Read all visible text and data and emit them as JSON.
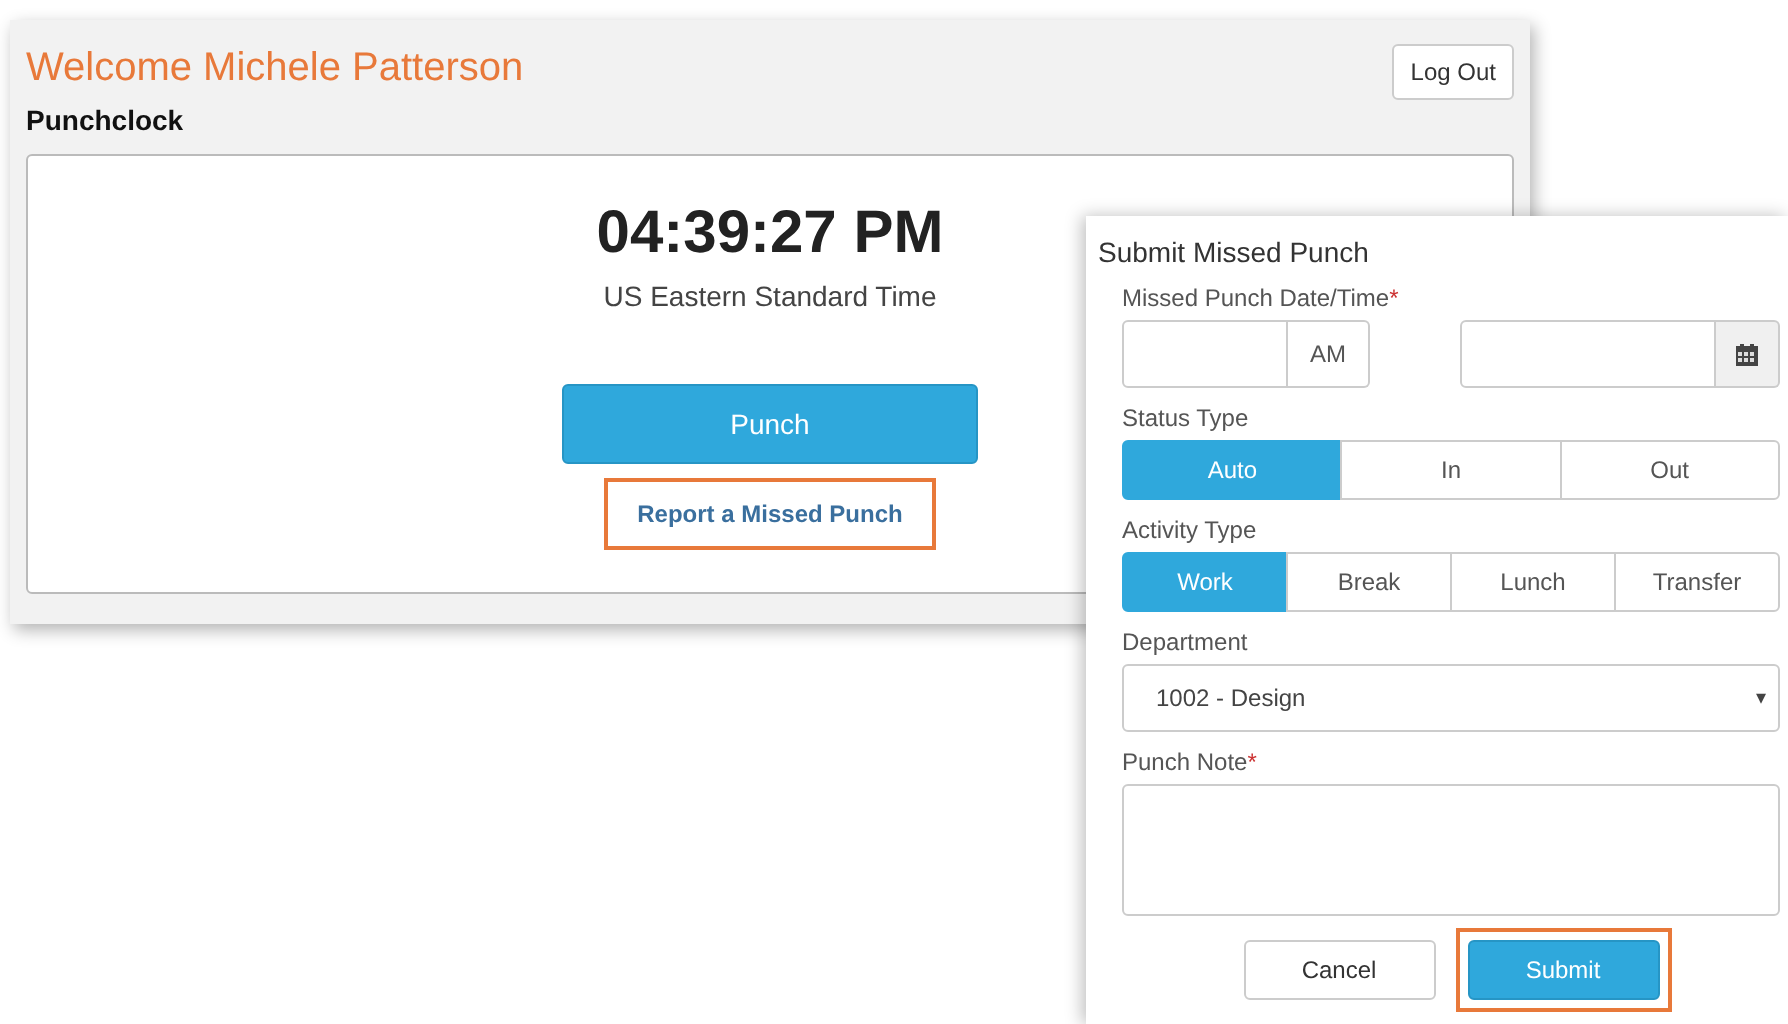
{
  "header": {
    "welcome": "Welcome Michele Patterson",
    "logout_button": "Log Out"
  },
  "punchclock": {
    "title": "Punchclock",
    "time": "04:39:27 PM",
    "timezone": "US Eastern Standard Time",
    "punch_button": "Punch",
    "missed_link": {
      "label": "Report a Missed Punch",
      "highlighted": true
    }
  },
  "dialog": {
    "title": "Submit Missed Punch",
    "datetime": {
      "label": "Missed Punch Date/Time",
      "required_mark": "*",
      "ampm": "AM"
    },
    "status_type": {
      "label": "Status Type",
      "options": [
        {
          "label": "Auto",
          "selected": true
        },
        {
          "label": "In",
          "selected": false
        },
        {
          "label": "Out",
          "selected": false
        }
      ]
    },
    "activity_type": {
      "label": "Activity Type",
      "options": [
        {
          "label": "Work",
          "selected": true
        },
        {
          "label": "Break",
          "selected": false
        },
        {
          "label": "Lunch",
          "selected": false
        },
        {
          "label": "Transfer",
          "selected": false
        }
      ]
    },
    "department": {
      "label": "Department",
      "value": "1002 - Design",
      "caret": "▾"
    },
    "note": {
      "label": "Punch Note",
      "required_mark": "*"
    },
    "buttons": [
      {
        "label": "Cancel",
        "kind": "secondary",
        "highlighted": false
      },
      {
        "label": "Submit",
        "kind": "primary",
        "highlighted": true
      }
    ]
  }
}
